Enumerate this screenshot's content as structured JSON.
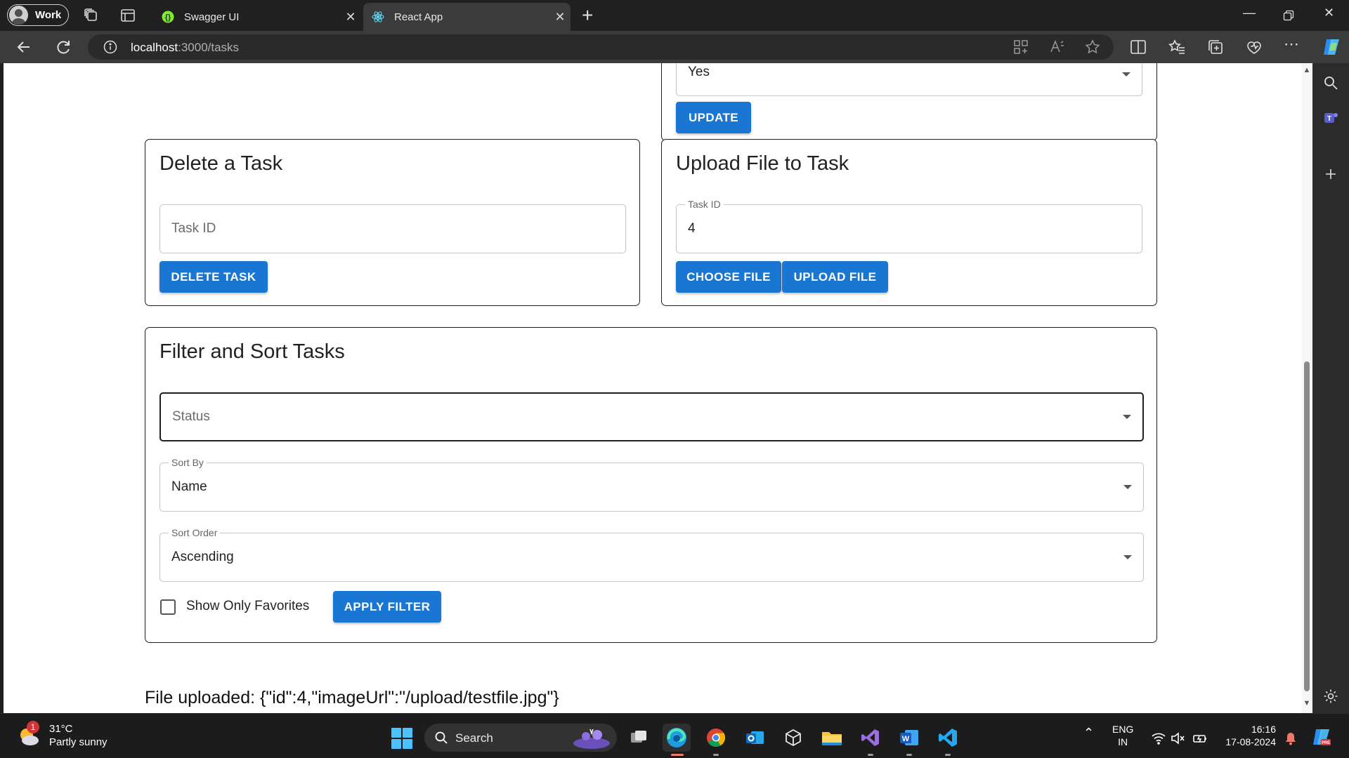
{
  "browser": {
    "profile_label": "Work",
    "tabs": [
      {
        "title": "Swagger UI",
        "active": false
      },
      {
        "title": "React App",
        "active": true
      }
    ],
    "address": {
      "host": "localhost",
      "path": ":3000/tasks"
    }
  },
  "page": {
    "update_card": {
      "select_value": "Yes",
      "update_button": "UPDATE"
    },
    "delete_card": {
      "title": "Delete a Task",
      "task_id_placeholder": "Task ID",
      "delete_button": "DELETE TASK"
    },
    "upload_card": {
      "title": "Upload File to Task",
      "task_id_label": "Task ID",
      "task_id_value": "4",
      "choose_button": "CHOOSE FILE",
      "upload_button": "UPLOAD FILE"
    },
    "filter_card": {
      "title": "Filter and Sort Tasks",
      "status_placeholder": "Status",
      "sort_by_label": "Sort By",
      "sort_by_value": "Name",
      "sort_order_label": "Sort Order",
      "sort_order_value": "Ascending",
      "favorites_label": "Show Only Favorites",
      "favorites_checked": false,
      "apply_button": "APPLY FILTER"
    },
    "status_message": "File uploaded: {\"id\":4,\"imageUrl\":\"/upload/testfile.jpg\"}"
  },
  "taskbar": {
    "weather": {
      "badge": "1",
      "temp": "31°C",
      "condition": "Partly sunny"
    },
    "search_label": "Search",
    "lang": {
      "line1": "ENG",
      "line2": "IN"
    },
    "clock": {
      "time": "16:16",
      "date": "17-08-2024"
    }
  },
  "colors": {
    "primary_button": "#1976d2",
    "browser_chrome": "#202020",
    "toolbar": "#3b3b3b"
  }
}
